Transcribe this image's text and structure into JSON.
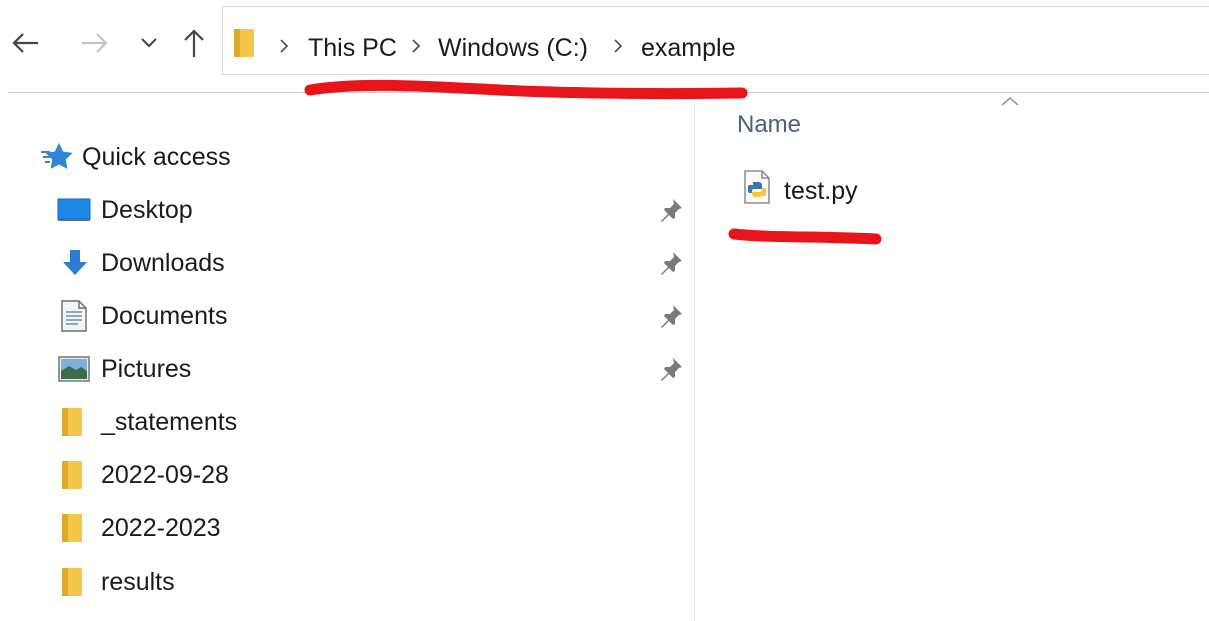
{
  "toolbar": {
    "back_icon": "arrow-left-icon",
    "forward_icon": "arrow-right-icon",
    "recent_icon": "chevron-down-icon",
    "up_icon": "arrow-up-icon"
  },
  "address": {
    "folder_icon": "folder-icon",
    "crumbs": [
      "This PC",
      "Windows (C:)",
      "example"
    ]
  },
  "sidebar": {
    "quick_access": "Quick access",
    "items": [
      {
        "label": "Desktop",
        "icon": "desktop-icon",
        "pinned": true
      },
      {
        "label": "Downloads",
        "icon": "download-icon",
        "pinned": true
      },
      {
        "label": "Documents",
        "icon": "document-icon",
        "pinned": true
      },
      {
        "label": "Pictures",
        "icon": "pictures-icon",
        "pinned": true
      },
      {
        "label": "_statements",
        "icon": "folder-icon",
        "pinned": false
      },
      {
        "label": "2022-09-28",
        "icon": "folder-icon",
        "pinned": false
      },
      {
        "label": "2022-2023",
        "icon": "folder-icon",
        "pinned": false
      },
      {
        "label": "results",
        "icon": "folder-icon",
        "pinned": false
      }
    ]
  },
  "content": {
    "column_name": "Name",
    "files": [
      {
        "name": "test.py",
        "icon": "python-file-icon"
      }
    ]
  },
  "colors": {
    "annotation_red": "#e8141b",
    "folder_yellow": "#f3c84a",
    "accent_blue": "#2b7cd3",
    "header_text": "#4c607a"
  }
}
